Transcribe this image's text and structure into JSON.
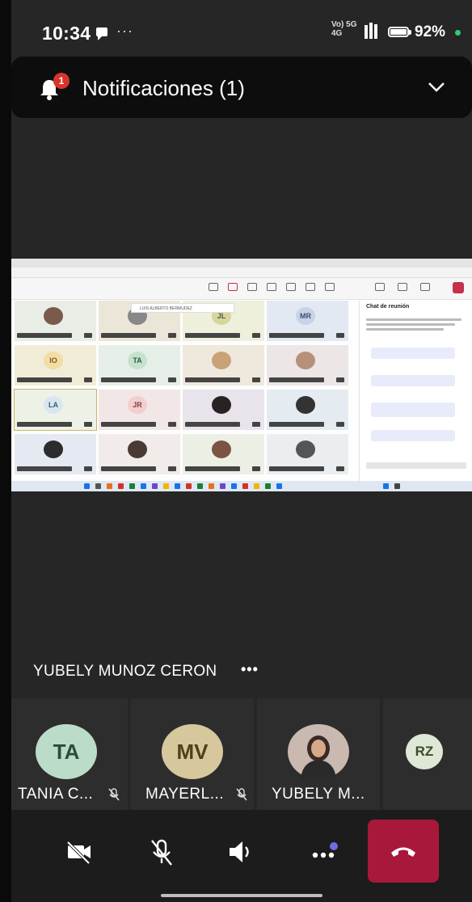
{
  "status_bar": {
    "time": "10:34",
    "overflow": "···",
    "network_top": "Vo) 5G",
    "network_bottom": "4G",
    "battery": "92%",
    "icons": [
      "message-icon",
      "signal-icon",
      "battery-icon"
    ]
  },
  "notification": {
    "count": "1",
    "title": "Notificaciones (1)"
  },
  "shared_screen": {
    "search_text": "LUIS ALBERTO BERMUDEZ",
    "chat_title": "Chat de reunión",
    "tiles": [
      {
        "initials": "",
        "photo": true
      },
      {
        "initials": "",
        "photo": true
      },
      {
        "initials": "JL",
        "photo": false
      },
      {
        "initials": "MR",
        "photo": false
      },
      {
        "initials": "IO",
        "photo": false
      },
      {
        "initials": "TA",
        "photo": false
      },
      {
        "initials": "",
        "photo": true
      },
      {
        "initials": "",
        "photo": true
      },
      {
        "initials": "LA",
        "photo": false
      },
      {
        "initials": "JR",
        "photo": false
      },
      {
        "initials": "",
        "photo": true
      },
      {
        "initials": "",
        "photo": true
      },
      {
        "initials": "",
        "photo": true
      },
      {
        "initials": "",
        "photo": true
      },
      {
        "initials": "",
        "photo": true
      },
      {
        "initials": "",
        "photo": true
      }
    ]
  },
  "pinned": {
    "name": "YUBELY MUNOZ CERON",
    "more": "•••"
  },
  "participants": [
    {
      "initials": "TA",
      "name": "TANIA C...",
      "muted": true,
      "color": "#bcdcca",
      "text_color": "#2e4b3a"
    },
    {
      "initials": "MV",
      "name": "MAYERL...",
      "muted": true,
      "color": "#d6c79d",
      "text_color": "#4e4119"
    },
    {
      "initials": "",
      "name": "YUBELY M...",
      "muted": false,
      "color": "#c9b9b0",
      "text_color": "#333333"
    },
    {
      "initials": "RZ",
      "name": "",
      "muted": false,
      "color": "#dfe8d6",
      "text_color": "#3a4a2c"
    }
  ],
  "controls": {
    "buttons": [
      "camera-off-icon",
      "mic-off-icon",
      "speaker-icon",
      "more-icon",
      "hang-up-icon"
    ],
    "accent": "#a8183a"
  }
}
